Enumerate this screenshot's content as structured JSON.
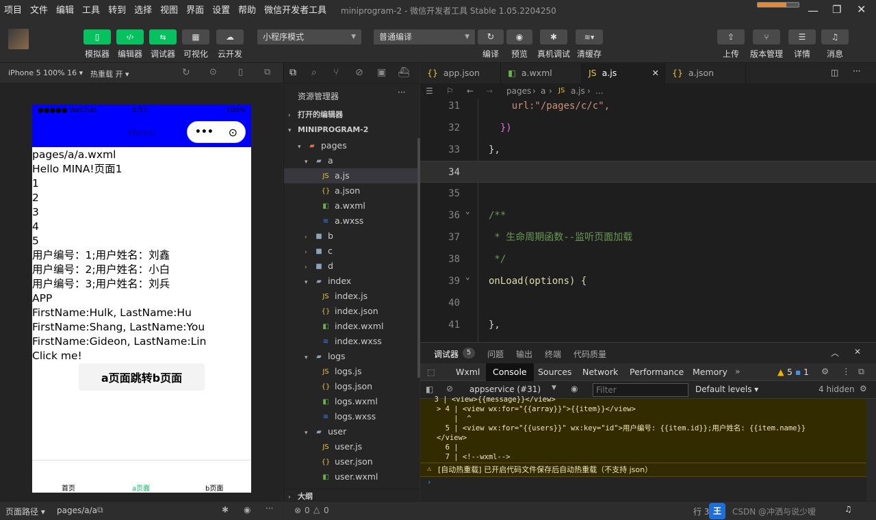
{
  "menu": [
    "项目",
    "文件",
    "编辑",
    "工具",
    "转到",
    "选择",
    "视图",
    "界面",
    "设置",
    "帮助",
    "微信开发者工具"
  ],
  "window_title": "miniprogram-2 - 微信开发者工具 Stable 1.05.2204250",
  "toolbar": {
    "left_buttons": [
      "模拟器",
      "编辑器",
      "调试器",
      "可视化",
      "云开发"
    ],
    "mode_select": "小程序模式",
    "compile_select": "普通编译",
    "mid_buttons": [
      "编译",
      "预览",
      "真机调试",
      "清缓存"
    ],
    "right_buttons": [
      "上传",
      "版本管理",
      "详情",
      "消息"
    ]
  },
  "simulator": {
    "device": "iPhone 5 100% 16",
    "hot_reload": "热重载 开",
    "status": {
      "carrier": "●●●●● WeChat",
      "time": "0:51",
      "battery": "100%"
    },
    "nav_title": "Weixin",
    "content_lines": [
      "pages/a/a.wxml",
      "Hello MINA!页面1",
      "1",
      "2",
      "3",
      "4",
      "5",
      "用户编号：1;用户姓名：刘鑫",
      "用户编号：2;用户姓名：小白",
      "用户编号：3;用户姓名：刘兵",
      "APP",
      "FirstName:Hulk, LastName:Hu",
      "FirstName:Shang, LastName:You",
      "FirstName:Gideon, LastName:Lin",
      "Click me!"
    ],
    "jump_button": "a页面跳转b页面",
    "tabbar": [
      "首页",
      "a页面",
      "b页面"
    ],
    "active_tab_color": "#07c160",
    "bottom_path_label": "页面路径",
    "bottom_path": "pages/a/a"
  },
  "explorer": {
    "title": "资源管理器",
    "open_editors": "打开的编辑器",
    "project": "MINIPROGRAM-2",
    "tree": [
      {
        "label": "pages",
        "icon": "folder-open-icon",
        "arrow": "▾"
      },
      {
        "label": "a",
        "icon": "folder-open-icon",
        "arrow": "▾"
      },
      {
        "label": "a.js",
        "icon": "js-file-icon",
        "arrow": ""
      },
      {
        "label": "a.json",
        "icon": "json-file-icon",
        "arrow": ""
      },
      {
        "label": "a.wxml",
        "icon": "wxml-file-icon",
        "arrow": ""
      },
      {
        "label": "a.wxss",
        "icon": "wxss-file-icon",
        "arrow": ""
      },
      {
        "label": "b",
        "icon": "folder-icon",
        "arrow": "›"
      },
      {
        "label": "c",
        "icon": "folder-icon",
        "arrow": "›"
      },
      {
        "label": "d",
        "icon": "folder-icon",
        "arrow": "›"
      },
      {
        "label": "index",
        "icon": "folder-open-icon",
        "arrow": "▾"
      },
      {
        "label": "index.js",
        "icon": "js-file-icon",
        "arrow": ""
      },
      {
        "label": "index.json",
        "icon": "json-file-icon",
        "arrow": ""
      },
      {
        "label": "index.wxml",
        "icon": "wxml-file-icon",
        "arrow": ""
      },
      {
        "label": "index.wxss",
        "icon": "wxss-file-icon",
        "arrow": ""
      },
      {
        "label": "logs",
        "icon": "folder-open-icon",
        "arrow": "▾"
      },
      {
        "label": "logs.js",
        "icon": "js-file-icon",
        "arrow": ""
      },
      {
        "label": "logs.json",
        "icon": "json-file-icon",
        "arrow": ""
      },
      {
        "label": "logs.wxml",
        "icon": "wxml-file-icon",
        "arrow": ""
      },
      {
        "label": "logs.wxss",
        "icon": "wxss-file-icon",
        "arrow": ""
      },
      {
        "label": "user",
        "icon": "folder-open-icon",
        "arrow": "▾"
      },
      {
        "label": "user.js",
        "icon": "js-file-icon",
        "arrow": ""
      },
      {
        "label": "user.json",
        "icon": "json-file-icon",
        "arrow": ""
      },
      {
        "label": "user.wxml",
        "icon": "wxml-file-icon",
        "arrow": ""
      }
    ],
    "outline": "大纲"
  },
  "editor": {
    "tabs": [
      "app.json",
      "a.wxml",
      "a.js",
      "a.json"
    ],
    "breadcrumb": [
      "pages",
      "a",
      "a.js",
      "..."
    ],
    "lines": [
      {
        "n": "31",
        "code": "    url:\"/pages/c/c\","
      },
      {
        "n": "32",
        "code": "  })"
      },
      {
        "n": "33",
        "code": "},"
      },
      {
        "n": "34",
        "code": ""
      },
      {
        "n": "35",
        "code": ""
      },
      {
        "n": "36",
        "code": "/**"
      },
      {
        "n": "37",
        "code": " * 生命周期函数--监听页面加载"
      },
      {
        "n": "38",
        "code": " */"
      },
      {
        "n": "39",
        "code": "onLoad(options) {"
      },
      {
        "n": "40",
        "code": ""
      },
      {
        "n": "41",
        "code": "},"
      }
    ]
  },
  "devtools": {
    "top_tabs": [
      "调试器",
      "问题",
      "输出",
      "终端",
      "代码质量"
    ],
    "badge": "5",
    "panel_tabs": [
      "Wxml",
      "Console",
      "Sources",
      "Network",
      "Performance",
      "Memory"
    ],
    "context": "appservice (#31)",
    "filter_placeholder": "Filter",
    "levels": "Default levels",
    "hidden": "4 hidden",
    "warn_count": "5",
    "info_count": "1",
    "console_lines": [
      "  3 | <view>{{message}}</view>",
      "> 4 | <view wx:for=\"{{array}}\">{{item}}</view>",
      "    |  ^",
      "  5 | <view wx:for=\"{{users}}\" wx:key=\"id\">用户编号: {{item.id}};用户姓名: {{item.name}}",
      "</view>",
      "  6 |",
      "  7 | <!--wxml-->"
    ],
    "hot_reload_msg": "[自动热重载] 已开启代码文件保存后自动热重载（不支持 json）"
  },
  "statusbar": {
    "errors": "0",
    "warnings": "0",
    "line": "行 34",
    "watermark": "CSDN @冲洒与说少嗳"
  }
}
